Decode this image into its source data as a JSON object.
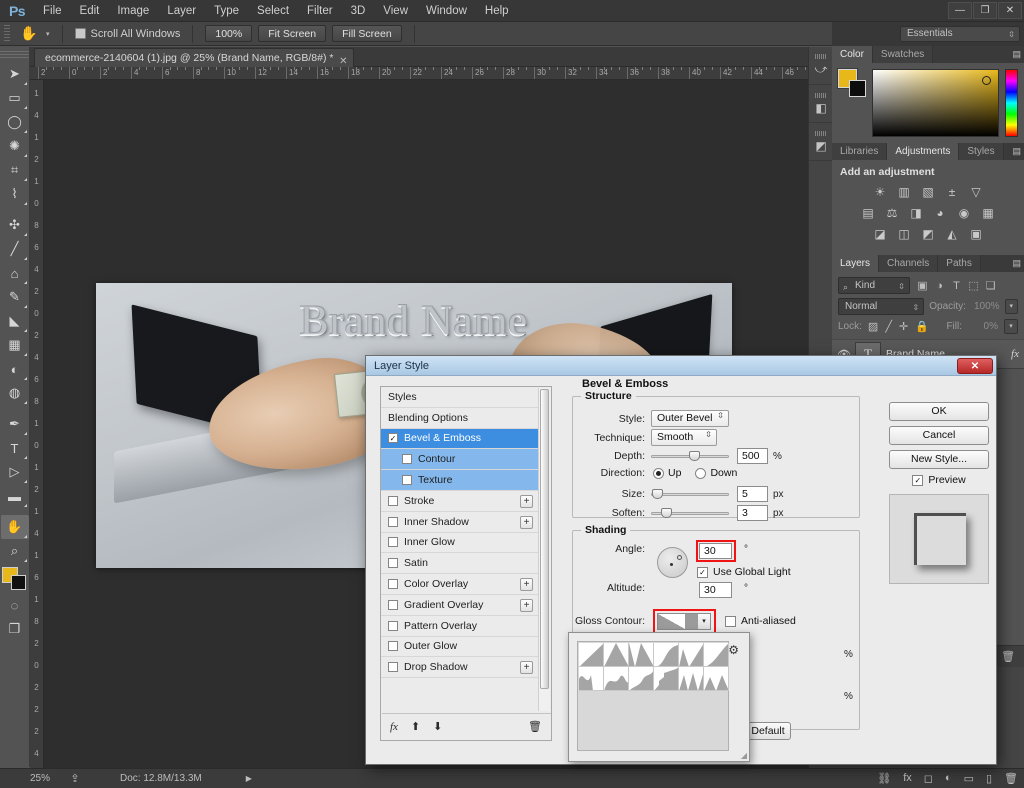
{
  "app": {
    "logo": "Ps",
    "menus": [
      "File",
      "Edit",
      "Image",
      "Layer",
      "Type",
      "Select",
      "Filter",
      "3D",
      "View",
      "Window",
      "Help"
    ],
    "window_controls": {
      "minimize": "—",
      "restore": "❐",
      "close": "✕"
    },
    "workspace": "Essentials"
  },
  "options_bar": {
    "tool_icon": "hand-tool-icon",
    "scroll_all_windows": "Scroll All Windows",
    "buttons": [
      "100%",
      "Fit Screen",
      "Fill Screen"
    ]
  },
  "document": {
    "tab_title": "ecommerce-2140604 (1).jpg @ 25%  (Brand Name, RGB/8#) *",
    "close_glyph": "✕",
    "canvas_text": "Brand Name"
  },
  "rulers": {
    "h_labels": [
      "2",
      "0",
      "2",
      "4",
      "6",
      "8",
      "10",
      "12",
      "14",
      "16",
      "18",
      "20",
      "22",
      "24",
      "26",
      "28",
      "30",
      "32",
      "34",
      "36",
      "38",
      "40",
      "42",
      "44",
      "46"
    ],
    "v_labels": [
      "1",
      "4",
      "1",
      "2",
      "1",
      "0",
      "8",
      "6",
      "4",
      "2",
      "0",
      "2",
      "4",
      "6",
      "8",
      "1",
      "0",
      "1",
      "2",
      "1",
      "4",
      "1",
      "6",
      "1",
      "8",
      "2",
      "0",
      "2",
      "2",
      "2",
      "4"
    ]
  },
  "toolbar": {
    "tools": [
      {
        "name": "move-tool",
        "glyph": "➤"
      },
      {
        "name": "marquee-tool",
        "glyph": "▭"
      },
      {
        "name": "lasso-tool",
        "glyph": "◯"
      },
      {
        "name": "quick-selection-tool",
        "glyph": "✺"
      },
      {
        "name": "crop-tool",
        "glyph": "⌗"
      },
      {
        "name": "eyedropper-tool",
        "glyph": "⌇"
      },
      {
        "name": "spot-healing-tool",
        "glyph": "✣"
      },
      {
        "name": "brush-tool",
        "glyph": "╱"
      },
      {
        "name": "clone-stamp-tool",
        "glyph": "⌂"
      },
      {
        "name": "history-brush-tool",
        "glyph": "✎"
      },
      {
        "name": "eraser-tool",
        "glyph": "◣"
      },
      {
        "name": "gradient-tool",
        "glyph": "▦"
      },
      {
        "name": "blur-tool",
        "glyph": "◐"
      },
      {
        "name": "dodge-tool",
        "glyph": "◍"
      },
      {
        "name": "pen-tool",
        "glyph": "✒"
      },
      {
        "name": "type-tool",
        "glyph": "T"
      },
      {
        "name": "path-selection-tool",
        "glyph": "▷"
      },
      {
        "name": "rectangle-tool",
        "glyph": "▬"
      },
      {
        "name": "hand-tool",
        "glyph": "✋"
      },
      {
        "name": "zoom-tool",
        "glyph": "⌕"
      }
    ],
    "foreground_color": "#e8b81b",
    "background_color": "#111111",
    "quick_mask": "◌",
    "screen_mode": "❐"
  },
  "panels": {
    "color": {
      "tabs": [
        "Color",
        "Swatches"
      ],
      "active_tab": "Color",
      "foreground": "#e8b81b",
      "background": "#0d0d0d"
    },
    "adjustments": {
      "tabs": [
        "Libraries",
        "Adjustments",
        "Styles"
      ],
      "active_tab": "Adjustments",
      "title": "Add an adjustment",
      "rows": [
        [
          {
            "name": "brightness-contrast-icon",
            "glyph": "☀"
          },
          {
            "name": "levels-icon",
            "glyph": "▥"
          },
          {
            "name": "curves-icon",
            "glyph": "▧"
          },
          {
            "name": "exposure-icon",
            "glyph": "±"
          },
          {
            "name": "vibrance-icon",
            "glyph": "▽"
          }
        ],
        [
          {
            "name": "hue-saturation-icon",
            "glyph": "▤"
          },
          {
            "name": "color-balance-icon",
            "glyph": "⚖"
          },
          {
            "name": "black-white-icon",
            "glyph": "◨"
          },
          {
            "name": "photo-filter-icon",
            "glyph": "◕"
          },
          {
            "name": "channel-mixer-icon",
            "glyph": "◉"
          },
          {
            "name": "color-lookup-icon",
            "glyph": "▦"
          }
        ],
        [
          {
            "name": "invert-icon",
            "glyph": "◪"
          },
          {
            "name": "posterize-icon",
            "glyph": "◫"
          },
          {
            "name": "threshold-icon",
            "glyph": "◩"
          },
          {
            "name": "selective-color-icon",
            "glyph": "◭"
          },
          {
            "name": "gradient-map-icon",
            "glyph": "▣"
          }
        ]
      ]
    },
    "layers": {
      "tabs": [
        "Layers",
        "Channels",
        "Paths"
      ],
      "active_tab": "Layers",
      "filter_kind": "Kind",
      "filter_icons": [
        {
          "name": "filter-pixel-icon",
          "glyph": "▣"
        },
        {
          "name": "filter-adjustment-icon",
          "glyph": "◑"
        },
        {
          "name": "filter-type-icon",
          "glyph": "T"
        },
        {
          "name": "filter-shape-icon",
          "glyph": "⬚"
        },
        {
          "name": "filter-smart-object-icon",
          "glyph": "❏"
        }
      ],
      "blend_mode": "Normal",
      "opacity_label": "Opacity:",
      "opacity_value": "100%",
      "lock_label": "Lock:",
      "lock_icons": [
        {
          "name": "lock-transparent-pixels-icon",
          "glyph": "▨"
        },
        {
          "name": "lock-image-pixels-icon",
          "glyph": "╱"
        },
        {
          "name": "lock-position-icon",
          "glyph": "✛"
        },
        {
          "name": "lock-all-icon",
          "glyph": "🔒"
        }
      ],
      "fill_label": "Fill:",
      "fill_value": "0%",
      "rows": [
        {
          "visible_icon": "👁",
          "thumb": "T",
          "name": "Brand Name",
          "fx": "fx"
        }
      ],
      "bottom_icons": [
        {
          "name": "link-layers-icon",
          "glyph": "⛓"
        },
        {
          "name": "layer-style-icon",
          "glyph": "fx"
        },
        {
          "name": "layer-mask-icon",
          "glyph": "◻"
        },
        {
          "name": "adjustment-layer-icon",
          "glyph": "◐"
        },
        {
          "name": "new-group-icon",
          "glyph": "▭"
        },
        {
          "name": "new-layer-icon",
          "glyph": "▯"
        },
        {
          "name": "delete-layer-icon",
          "glyph": "🗑"
        }
      ]
    }
  },
  "status_bar": {
    "zoom": "25%",
    "share_icon": "share-icon",
    "doc_info": "Doc: 12.8M/13.3M",
    "arrow": "▶"
  },
  "dialog": {
    "title": "Layer Style",
    "close_glyph": "✕",
    "styles_header": "Styles",
    "blending_options": "Blending Options",
    "style_items": [
      {
        "label": "Styles",
        "type": "header",
        "checkbox": false,
        "checked": false,
        "plus": false,
        "selected": false,
        "child": false
      },
      {
        "label": "Blending Options",
        "type": "header",
        "checkbox": false,
        "checked": false,
        "plus": false,
        "selected": false,
        "child": false
      },
      {
        "label": "Bevel & Emboss",
        "type": "effect",
        "checkbox": true,
        "checked": true,
        "plus": false,
        "selected": true,
        "child": false
      },
      {
        "label": "Contour",
        "type": "effect",
        "checkbox": true,
        "checked": false,
        "plus": false,
        "selected": false,
        "child": true
      },
      {
        "label": "Texture",
        "type": "effect",
        "checkbox": true,
        "checked": false,
        "plus": false,
        "selected": false,
        "child": true
      },
      {
        "label": "Stroke",
        "type": "effect",
        "checkbox": true,
        "checked": false,
        "plus": true,
        "selected": false,
        "child": false
      },
      {
        "label": "Inner Shadow",
        "type": "effect",
        "checkbox": true,
        "checked": false,
        "plus": true,
        "selected": false,
        "child": false
      },
      {
        "label": "Inner Glow",
        "type": "effect",
        "checkbox": true,
        "checked": false,
        "plus": false,
        "selected": false,
        "child": false
      },
      {
        "label": "Satin",
        "type": "effect",
        "checkbox": true,
        "checked": false,
        "plus": false,
        "selected": false,
        "child": false
      },
      {
        "label": "Color Overlay",
        "type": "effect",
        "checkbox": true,
        "checked": false,
        "plus": true,
        "selected": false,
        "child": false
      },
      {
        "label": "Gradient Overlay",
        "type": "effect",
        "checkbox": true,
        "checked": false,
        "plus": true,
        "selected": false,
        "child": false
      },
      {
        "label": "Pattern Overlay",
        "type": "effect",
        "checkbox": true,
        "checked": false,
        "plus": false,
        "selected": false,
        "child": false
      },
      {
        "label": "Outer Glow",
        "type": "effect",
        "checkbox": true,
        "checked": false,
        "plus": false,
        "selected": false,
        "child": false
      },
      {
        "label": "Drop Shadow",
        "type": "effect",
        "checkbox": true,
        "checked": false,
        "plus": true,
        "selected": false,
        "child": false
      }
    ],
    "list_footer_icons": [
      {
        "name": "fx-icon",
        "glyph": "fx"
      },
      {
        "name": "move-up-icon",
        "glyph": "⬆"
      },
      {
        "name": "move-down-icon",
        "glyph": "⬇"
      },
      {
        "name": "delete-effect-icon",
        "glyph": "🗑"
      }
    ],
    "section_title": "Bevel & Emboss",
    "structure": {
      "legend": "Structure",
      "style_label": "Style:",
      "style_value": "Outer Bevel",
      "technique_label": "Technique:",
      "technique_value": "Smooth",
      "depth_label": "Depth:",
      "depth_value": "500",
      "depth_unit": "%",
      "direction_label": "Direction:",
      "direction_up": "Up",
      "direction_down": "Down",
      "direction_selected": "Up",
      "size_label": "Size:",
      "size_value": "5",
      "size_unit": "px",
      "soften_label": "Soften:",
      "soften_value": "3",
      "soften_unit": "px"
    },
    "shading": {
      "legend": "Shading",
      "angle_label": "Angle:",
      "angle_value": "30",
      "angle_unit": "°",
      "use_global_light": "Use Global Light",
      "use_global_light_checked": true,
      "altitude_label": "Altitude:",
      "altitude_value": "30",
      "altitude_unit": "°",
      "gloss_contour_label": "Gloss Contour:",
      "anti_aliased": "Anti-aliased",
      "anti_aliased_checked": false
    },
    "buttons": {
      "ok": "OK",
      "cancel": "Cancel",
      "new_style": "New Style...",
      "preview": "Preview",
      "preview_checked": true,
      "default": "Default"
    },
    "highlight_color": "#f01414"
  },
  "contour_picker": {
    "gear_icon": "gear-icon",
    "presets": [
      "linear",
      "cone",
      "cone-inverted",
      "cove-deep",
      "half-round",
      "ring",
      "ring-double",
      "gaussian",
      "rolling-slope",
      "rounded-steps",
      "sawtooth-1",
      "sawtooth-2"
    ]
  }
}
